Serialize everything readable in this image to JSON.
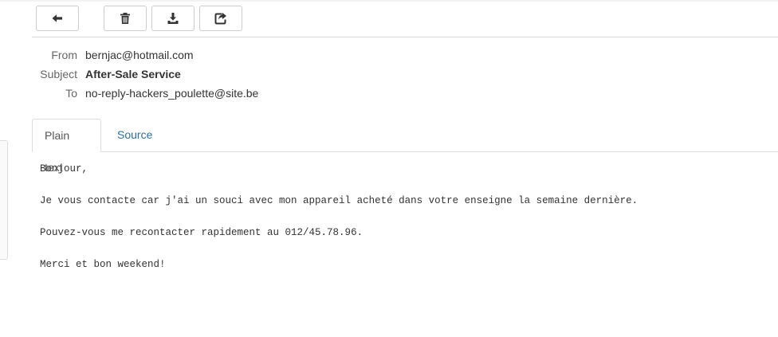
{
  "toolbar": {
    "buttons": [
      {
        "icon": "arrow-left-icon"
      },
      {
        "icon": "trash-icon"
      },
      {
        "icon": "download-icon"
      },
      {
        "icon": "share-icon"
      }
    ]
  },
  "headers": {
    "from_label": "From",
    "from_value": "bernjac@hotmail.com",
    "subject_label": "Subject",
    "subject_value": "After-Sale Service",
    "to_label": "To",
    "to_value": "no-reply-hackers_poulette@site.be"
  },
  "tabs": {
    "plain_text": "Plain text",
    "source": "Source",
    "active": "Plain text"
  },
  "message": {
    "lines": [
      "Bonjour,",
      "",
      "Je vous contacte car j'ai un souci avec mon appareil acheté dans votre enseigne la semaine dernière.",
      "",
      "Pouvez-vous me recontacter rapidement au 012/45.78.96.",
      "",
      "Merci et bon weekend!"
    ]
  },
  "colors": {
    "link": "#2a6fa8",
    "border": "#cccccc",
    "label": "#666666"
  }
}
